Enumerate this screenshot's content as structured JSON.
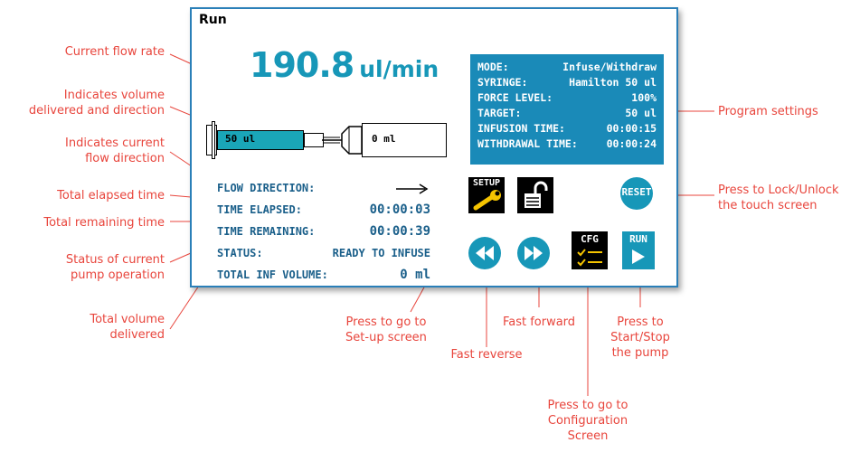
{
  "screen": {
    "title": "Run",
    "flow_rate": {
      "value": "190.8",
      "unit": "ul/min"
    },
    "syringe_volume": "50 ul",
    "delivered_volume": "0 ml",
    "settings": [
      {
        "label": "MODE:",
        "value": "Infuse/Withdraw"
      },
      {
        "label": "SYRINGE:",
        "value": "Hamilton 50 ul"
      },
      {
        "label": "FORCE LEVEL:",
        "value": "100%"
      },
      {
        "label": "TARGET:",
        "value": "50 ul"
      },
      {
        "label": "INFUSION TIME:",
        "value": "00:00:15"
      },
      {
        "label": "WITHDRAWAL TIME:",
        "value": "00:00:24"
      }
    ],
    "status": {
      "flow_direction_label": "FLOW DIRECTION:",
      "flow_direction_icon": "arrow-right-icon",
      "time_elapsed_label": "TIME ELAPSED:",
      "time_elapsed": "00:00:03",
      "time_remaining_label": "TIME REMAINING:",
      "time_remaining": "00:00:39",
      "status_label": "STATUS:",
      "status_value": "READY TO INFUSE",
      "total_inf_label": "TOTAL INF VOLUME:",
      "total_inf_value": "0 ml"
    },
    "buttons": {
      "setup": "SETUP",
      "lock_icon": "unlock-icon",
      "reset": "RESET",
      "reverse_icon": "fast-reverse-icon",
      "forward_icon": "fast-forward-icon",
      "cfg": "CFG",
      "run": "RUN"
    }
  },
  "annotations": {
    "current_flow_rate": "Current flow rate",
    "volume_delivered_line1": "Indicates volume",
    "volume_delivered_line2": "delivered and direction",
    "current_direction_line1": "Indicates current",
    "current_direction_line2": "flow direction",
    "elapsed": "Total elapsed time",
    "remaining": "Total remaining time",
    "status_line1": "Status of current",
    "status_line2": "pump operation",
    "total_vol_line1": "Total volume",
    "total_vol_line2": "delivered",
    "program_settings": "Program settings",
    "lock_line1": "Press to  Lock/Unlock",
    "lock_line2": "the touch screen",
    "setup_line1": "Press to  go  to",
    "setup_line2": "Set-up screen",
    "fast_reverse": "Fast reverse",
    "fast_forward": "Fast forward",
    "run_line1": "Press to",
    "run_line2": "Start/Stop",
    "run_line3": "the pump",
    "cfg_line1": "Press to  go  to",
    "cfg_line2": "Configuration",
    "cfg_line3": "Screen"
  },
  "colors": {
    "annotation": "#e8453c",
    "accent": "#1797b8",
    "panel": "#1a8ab8",
    "status_text": "#1a5f8a"
  }
}
